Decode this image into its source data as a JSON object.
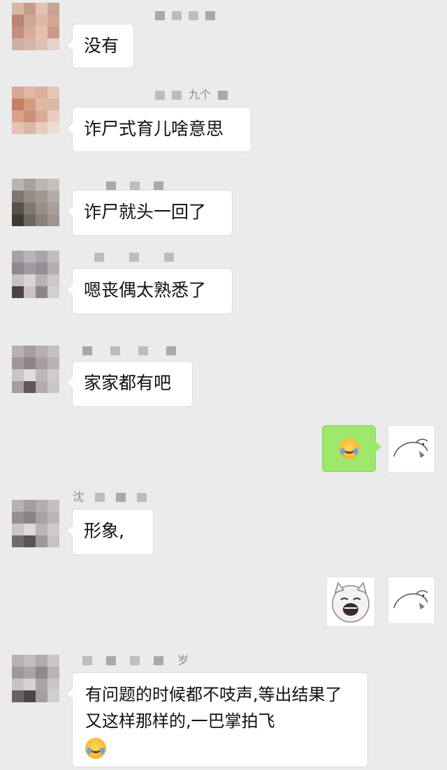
{
  "colors": {
    "background": "#ebebeb",
    "bubble_incoming": "#ffffff",
    "bubble_outgoing": "#9de86b"
  },
  "messages": [
    {
      "type": "incoming",
      "nickname": "",
      "text": "没有"
    },
    {
      "type": "incoming",
      "nickname": "九个",
      "text": "诈尸式育儿啥意思"
    },
    {
      "type": "incoming",
      "nickname": "",
      "text": "诈尸就头一回了"
    },
    {
      "type": "incoming",
      "nickname": "",
      "text": "嗯丧偶太熟悉了"
    },
    {
      "type": "incoming",
      "nickname": "",
      "text": "家家都有吧"
    },
    {
      "type": "outgoing",
      "content": "crying-laughing-emoji"
    },
    {
      "type": "incoming",
      "nickname": "沈",
      "text": "形象,"
    },
    {
      "type": "outgoing",
      "content": "laughing-cat-sticker"
    },
    {
      "type": "incoming",
      "nickname": "岁",
      "text": "有问题的时候都不吱声,等出结果了又这样那样的,一巴掌拍飞",
      "trailing_icon": "crying-laughing-emoji"
    }
  ]
}
